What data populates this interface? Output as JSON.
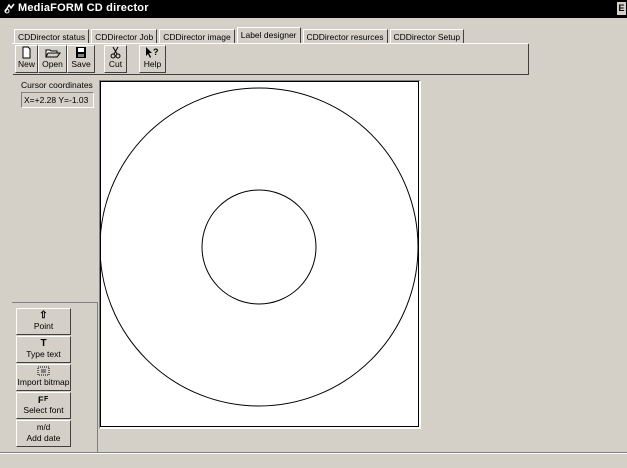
{
  "window": {
    "title": "MediaFORM CD director"
  },
  "tabs": [
    {
      "label": "CDDirector status"
    },
    {
      "label": "CDDirector Job"
    },
    {
      "label": "CDDirector image"
    },
    {
      "label": "Label designer",
      "active": true
    },
    {
      "label": "CDDirector resurces"
    },
    {
      "label": "CDDirector Setup"
    }
  ],
  "toolbar": {
    "new_label": "New",
    "open_label": "Open",
    "save_label": "Save",
    "cut_label": "Cut",
    "help_label": "Help"
  },
  "cursor": {
    "label": "Cursor coordinates",
    "value": "X=+2.28  Y=-1.03"
  },
  "tools": {
    "point": "Point",
    "type_text": "Type text",
    "import_bitmap": "Import bitmap",
    "select_font": "Select font",
    "add_date": "Add date",
    "add_date_icon": "m/d",
    "type_text_icon": "T"
  }
}
